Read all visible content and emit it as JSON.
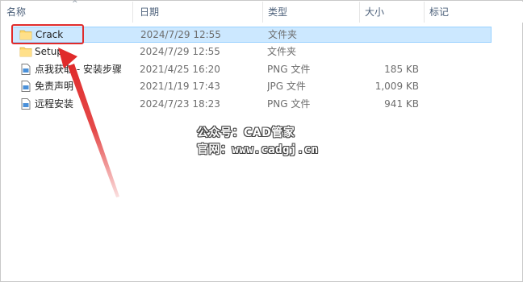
{
  "columns": {
    "name": "名称",
    "date": "日期",
    "type": "类型",
    "size": "大小",
    "tags": "标记"
  },
  "files": [
    {
      "name": "Crack",
      "date": "2024/7/29 12:55",
      "type": "文件夹",
      "size": "",
      "icon": "folder-icon",
      "selected": true
    },
    {
      "name": "Setup",
      "date": "2024/7/29 12:55",
      "type": "文件夹",
      "size": "",
      "icon": "folder-icon",
      "selected": false
    },
    {
      "name": "点我获取 - 安装步骤",
      "date": "2021/4/25 16:20",
      "type": "PNG 文件",
      "size": "185 KB",
      "icon": "image-file-icon",
      "selected": false
    },
    {
      "name": "免责声明",
      "date": "2021/1/19 17:43",
      "type": "JPG 文件",
      "size": "1,009 KB",
      "icon": "image-file-icon",
      "selected": false
    },
    {
      "name": "远程安装",
      "date": "2024/7/23 18:23",
      "type": "PNG 文件",
      "size": "941 KB",
      "icon": "image-file-icon",
      "selected": false
    }
  ],
  "watermark": {
    "line1": "公众号：CAD管家",
    "line2": "官网：www.cadgj.cn"
  },
  "colors": {
    "selection_bg": "#cce8ff",
    "selection_border": "#99d1ff",
    "highlight_red": "#e02b2b",
    "folder_yellow": "#ffd766",
    "header_text": "#4c607a"
  }
}
